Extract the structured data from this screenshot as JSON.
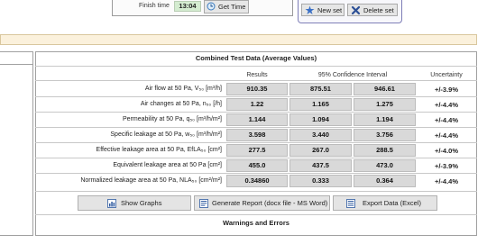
{
  "top": {
    "finish_time_label": "Finish time",
    "finish_time_value": "13:04",
    "get_time_label": "Get Time",
    "new_set_label": "New set",
    "delete_set_label": "Delete set"
  },
  "combined": {
    "title": "Combined Test Data (Average Values)",
    "col_results": "Results",
    "col_ci": "95% Confidence Interval",
    "col_uncertainty": "Uncertainty",
    "rows": [
      {
        "label": "Air flow at 50 Pa, V₅₀ [m³/h]",
        "result": "910.35",
        "ci_low": "875.51",
        "ci_high": "946.61",
        "uncertainty": "+/-3.9%"
      },
      {
        "label": "Air changes at 50 Pa, n₅₀ [/h]",
        "result": "1.22",
        "ci_low": "1.165",
        "ci_high": "1.275",
        "uncertainty": "+/-4.4%"
      },
      {
        "label": "Permeability at 50 Pa, q₅₀ [m³/h/m²]",
        "result": "1.144",
        "ci_low": "1.094",
        "ci_high": "1.194",
        "uncertainty": "+/-4.4%"
      },
      {
        "label": "Specific leakage at 50 Pa, w₅₀ [m³/h/m²]",
        "result": "3.598",
        "ci_low": "3.440",
        "ci_high": "3.756",
        "uncertainty": "+/-4.4%"
      },
      {
        "label": "Effective leakage area at 50 Pa, EfLA₅₀ [cm²]",
        "result": "277.5",
        "ci_low": "267.0",
        "ci_high": "288.5",
        "uncertainty": "+/-4.0%"
      },
      {
        "label": "Equivalent leakage area at 50 Pa [cm²]",
        "result": "455.0",
        "ci_low": "437.5",
        "ci_high": "473.0",
        "uncertainty": "+/-3.9%"
      },
      {
        "label": "Normalized leakage area at 50 Pa, NLA₅₀ [cm²/m²]",
        "result": "0.34860",
        "ci_low": "0.333",
        "ci_high": "0.364",
        "uncertainty": "+/-4.4%"
      }
    ]
  },
  "buttons": {
    "show_graphs": "Show Graphs",
    "generate_report": "Generate Report (docx file - MS Word)",
    "export_data": "Export Data (Excel)"
  },
  "warnings_title": "Warnings and Errors",
  "colors": {
    "cell_bg": "#d9d9d9",
    "beige_bar": "#fbf1dc",
    "finish_time_bg": "#d4ecd0",
    "set_box_border": "#7f7fb8"
  },
  "icons": [
    "clock-icon",
    "star-icon",
    "x-delete-icon",
    "graph-icon",
    "word-doc-icon",
    "excel-icon"
  ]
}
